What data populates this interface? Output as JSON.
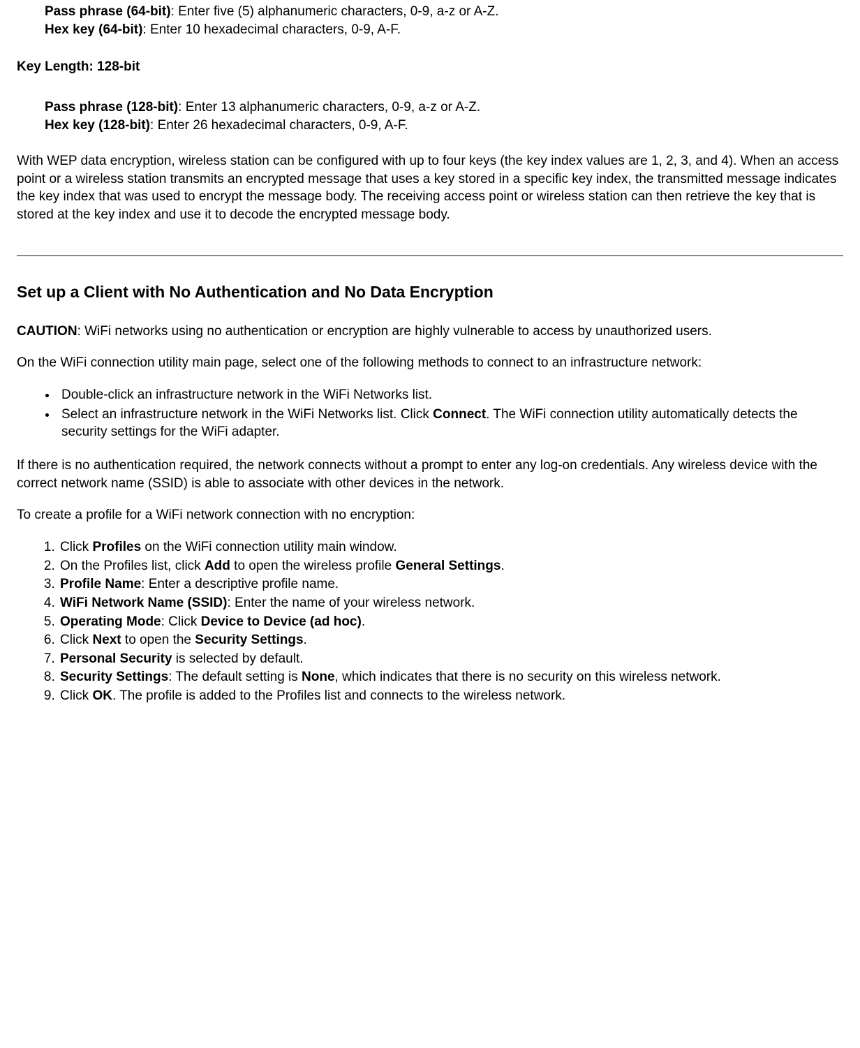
{
  "wep": {
    "k64_pass_label": "Pass phrase (64-bit)",
    "k64_pass_text": ": Enter five (5) alphanumeric characters, 0-9, a-z or A-Z.",
    "k64_hex_label": "Hex key (64-bit)",
    "k64_hex_text": ": Enter 10 hexadecimal characters, 0-9, A-F.",
    "key128_heading": "Key Length: 128-bit",
    "k128_pass_label": "Pass phrase (128-bit)",
    "k128_pass_text": ": Enter 13 alphanumeric characters, 0-9, a-z or A-Z.",
    "k128_hex_label": "Hex key (128-bit)",
    "k128_hex_text": ": Enter 26 hexadecimal characters, 0-9, A-F.",
    "wep_paragraph": "With WEP data encryption, wireless station can be configured with up to four keys (the key index values are 1, 2, 3, and 4). When an access point or a wireless station transmits an encrypted message that uses a key stored in a specific key index, the transmitted message indicates the key index that was used to encrypt the message body. The receiving access point or wireless station can then retrieve the key that is stored at the key index and use it to decode the encrypted message body."
  },
  "noauth": {
    "heading": "Set up a Client with No Authentication and No Data Encryption",
    "caution_label": "CAUTION",
    "caution_text": ": WiFi networks using no authentication or encryption are highly vulnerable to access by unauthorized users.",
    "intro_methods": "On the WiFi connection utility main page, select one of the following methods to connect to an infrastructure network:",
    "bullet1": "Double-click an infrastructure network in the WiFi Networks list.",
    "bullet2_a": "Select an infrastructure network in the WiFi Networks list. Click ",
    "bullet2_b": "Connect",
    "bullet2_c": ". The WiFi connection utility automatically detects the security settings for the WiFi adapter.",
    "no_auth_para": "If there is no authentication required, the network connects without a prompt to enter any log-on credentials. Any wireless device with the correct network name (SSID) is able to associate with other devices in the network.",
    "create_intro": "To create a profile for a WiFi network connection with no encryption:",
    "steps": {
      "s1a": "Click ",
      "s1b": "Profiles",
      "s1c": " on the WiFi connection utility main window.",
      "s2a": "On the Profiles list, click ",
      "s2b": "Add",
      "s2c": " to open the wireless profile ",
      "s2d": "General Settings",
      "s2e": ".",
      "s3a": "Profile Name",
      "s3b": ": Enter a descriptive profile name.",
      "s4a": "WiFi Network Name (SSID)",
      "s4b": ": Enter the name of your wireless network.",
      "s5a": "Operating Mode",
      "s5b": ": Click ",
      "s5c": "Device to Device (ad hoc)",
      "s5d": ".",
      "s6a": "Click ",
      "s6b": "Next",
      "s6c": " to open the ",
      "s6d": "Security Settings",
      "s6e": ".",
      "s7a": "Personal Security",
      "s7b": " is selected by default.",
      "s8a": "Security Settings",
      "s8b": ": The default setting is ",
      "s8c": "None",
      "s8d": ", which indicates that there is no security on this wireless network.",
      "s9a": "Click ",
      "s9b": "OK",
      "s9c": ". The profile is added to the Profiles list and connects to the wireless network."
    }
  }
}
